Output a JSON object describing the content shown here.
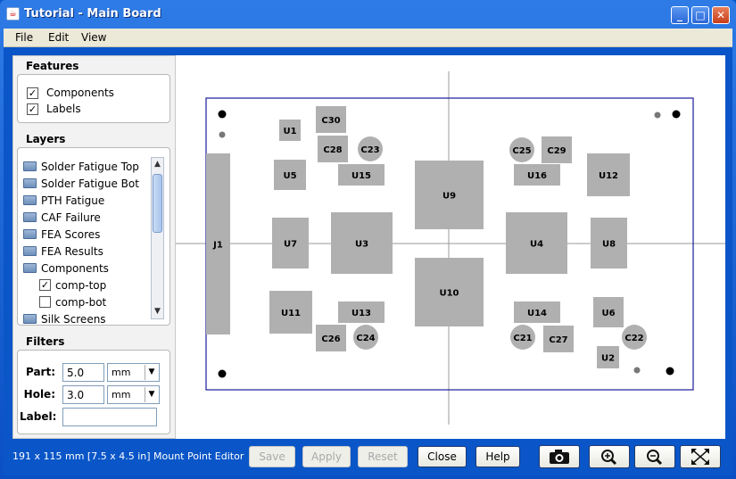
{
  "window": {
    "title": "Tutorial - Main Board",
    "minimize": "_",
    "maximize": "□",
    "close": "✕"
  },
  "menu": {
    "items": [
      "File",
      "Edit",
      "View"
    ]
  },
  "features": {
    "title": "Features",
    "items": [
      {
        "label": "Components",
        "checked": "✓"
      },
      {
        "label": "Labels",
        "checked": "✓"
      }
    ]
  },
  "layers": {
    "title": "Layers",
    "items": [
      {
        "label": "Solder Fatigue Top"
      },
      {
        "label": "Solder Fatigue Bot"
      },
      {
        "label": "PTH Fatigue"
      },
      {
        "label": "CAF Failure"
      },
      {
        "label": "FEA Scores"
      },
      {
        "label": "FEA Results"
      },
      {
        "label": "Components"
      },
      {
        "label": "comp-top",
        "checked": "✓"
      },
      {
        "label": "comp-bot",
        "checked": ""
      },
      {
        "label": "Silk Screens"
      }
    ]
  },
  "filters": {
    "title": "Filters",
    "part": {
      "label": "Part:",
      "value": "5.0",
      "unit": "mm"
    },
    "hole": {
      "label": "Hole:",
      "value": "3.0",
      "unit": "mm"
    },
    "labelField": {
      "label": "Label:",
      "value": ""
    }
  },
  "board": {
    "components": [
      {
        "name": "U1"
      },
      {
        "name": "C30"
      },
      {
        "name": "C28"
      },
      {
        "name": "C23"
      },
      {
        "name": "U5"
      },
      {
        "name": "U15"
      },
      {
        "name": "J1"
      },
      {
        "name": "U7"
      },
      {
        "name": "U3"
      },
      {
        "name": "U9"
      },
      {
        "name": "U10"
      },
      {
        "name": "U11"
      },
      {
        "name": "U13"
      },
      {
        "name": "C26"
      },
      {
        "name": "C24"
      },
      {
        "name": "C25"
      },
      {
        "name": "C29"
      },
      {
        "name": "U16"
      },
      {
        "name": "U12"
      },
      {
        "name": "U4"
      },
      {
        "name": "U8"
      },
      {
        "name": "U14"
      },
      {
        "name": "U6"
      },
      {
        "name": "C21"
      },
      {
        "name": "C27"
      },
      {
        "name": "C22"
      },
      {
        "name": "U2"
      }
    ]
  },
  "status": {
    "dimensions": "191 x 115 mm  [7.5 x 4.5 in]",
    "mode": "Mount Point Editor"
  },
  "buttons": {
    "save": "Save",
    "apply": "Apply",
    "reset": "Reset",
    "close": "Close",
    "help": "Help"
  },
  "icons": {
    "camera": "camera-icon",
    "zoom_in": "zoom-in-icon",
    "zoom_out": "zoom-out-icon",
    "fit": "fit-to-window-icon"
  },
  "colors": {
    "titlebar": "#0a56c8",
    "component": "#b0b0b0",
    "board_outline": "#1a1aa0"
  }
}
